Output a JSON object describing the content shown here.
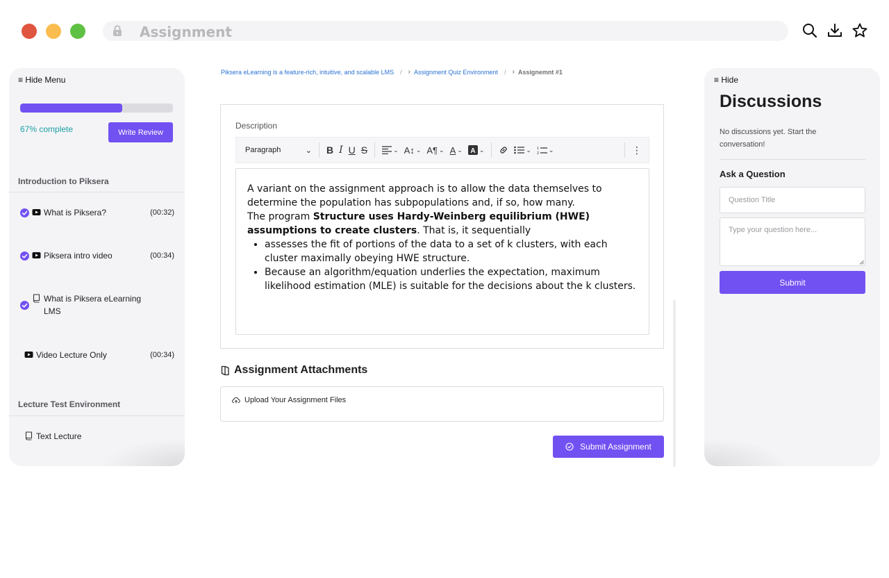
{
  "browser": {
    "page_title": "Assignment",
    "traffic_colors": [
      "#e0553f",
      "#fbbd4f",
      "#5fc143"
    ]
  },
  "left_panel": {
    "menu_toggle": "≡ Hide Menu",
    "progress_fraction": 0.67,
    "progress_text": "67% complete",
    "write_review_label": "Write Review",
    "sections": [
      {
        "title": "Introduction to Piksera",
        "lessons": [
          {
            "label": "What is Piksera?",
            "duration": "(00:32)",
            "type": "video-icon",
            "completed": true
          },
          {
            "label": "Piksera intro video",
            "duration": "(00:34)",
            "type": "video-icon",
            "completed": true
          },
          {
            "label": "What is Piksera eLearning LMS",
            "duration": "",
            "type": "text-lesson-icon",
            "completed": true
          },
          {
            "label": "Video Lecture Only",
            "duration": "(00:34)",
            "type": "video-icon",
            "completed": false
          }
        ]
      },
      {
        "title": "Lecture Test Environment",
        "lessons": [
          {
            "label": "Text Lecture",
            "duration": "",
            "type": "text-lesson-icon",
            "completed": false
          }
        ]
      }
    ]
  },
  "breadcrumb": {
    "items": [
      "Piksera eLearning is a feature-rich, intuitive, and scalable LMS",
      "Assignment Quiz Environment",
      "Assignemnt #1"
    ],
    "separator": "/"
  },
  "description": {
    "label": "Description",
    "toolbar": {
      "block_format": "Paragraph"
    },
    "editor": {
      "line1": "A variant on the assignment approach is to allow the data themselves to determine the population has subpopulations and, if so, how many.",
      "line2_prefix": "The program ",
      "line2_bold": "Structure uses Hardy-Weinberg equilibrium (HWE) assumptions to create clusters",
      "line2_suffix": ". That is, it sequentially",
      "bullets": [
        " assesses the fit of portions of the data to a set of k clusters, with each cluster maximally obeying HWE structure.",
        "Because an algorithm/equation underlies the expectation, maximum likelihood estimation (MLE) is suitable for the decisions about the k clusters."
      ]
    }
  },
  "attachments": {
    "title": "Assignment Attachments",
    "upload_label": "Upload Your Assignment Files"
  },
  "submit_assignment_label": "Submit Assignment",
  "discussions": {
    "toggle": "≡ Hide",
    "title": "Discussions",
    "empty_text": "No discussions yet. Start the conversation!",
    "ask_label": "Ask a Question",
    "title_placeholder": "Question Title",
    "body_placeholder": "Type your question here...",
    "submit_label": "Submit"
  },
  "colors": {
    "accent": "#7251f2",
    "progress_text": "#1a9ea5",
    "link": "#2a72d4"
  }
}
